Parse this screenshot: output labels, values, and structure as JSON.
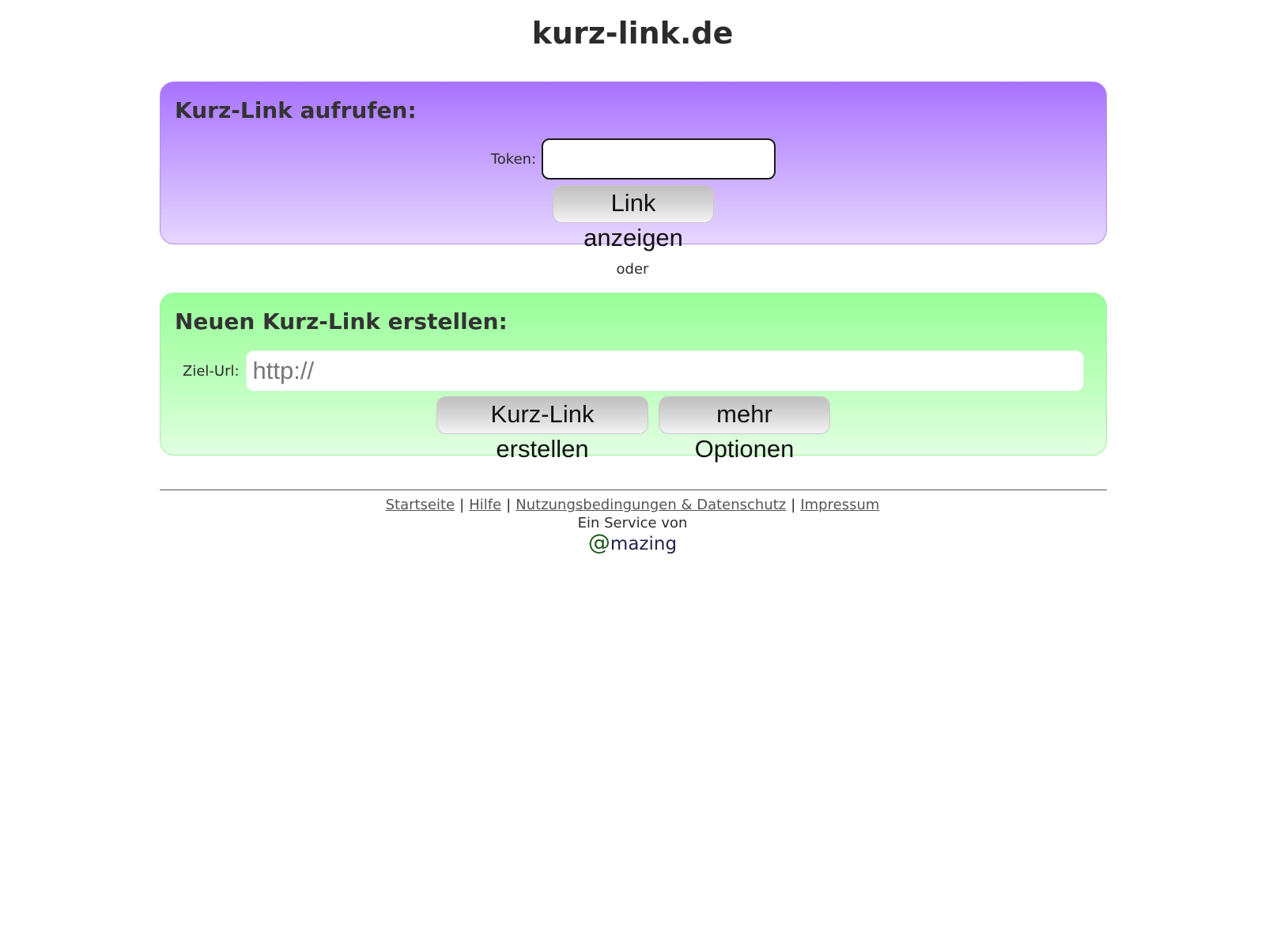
{
  "site": {
    "title": "kurz-link.de"
  },
  "open_link": {
    "heading": "Kurz-Link aufrufen:",
    "token_label": "Token:",
    "token_value": "",
    "submit_label": "Link anzeigen"
  },
  "separator": "oder",
  "create_link": {
    "heading": "Neuen Kurz-Link erstellen:",
    "url_label": "Ziel-Url:",
    "url_placeholder": "http://",
    "create_label": "Kurz-Link erstellen",
    "options_label": "mehr Optionen"
  },
  "footer": {
    "links": [
      "Startseite",
      "Hilfe",
      "Nutzungsbedingungen & Datenschutz",
      "Impressum"
    ],
    "link_separator": "|",
    "service_text": "Ein Service von",
    "brand_at": "@",
    "brand_rest": "mazing"
  },
  "colors": {
    "purple_panel_top": "#a872ff",
    "purple_panel_bottom": "#e6d7ff",
    "green_panel_top": "#99ff99",
    "green_panel_bottom": "#e2ffe2",
    "brand_at": "#1e5a1e"
  }
}
